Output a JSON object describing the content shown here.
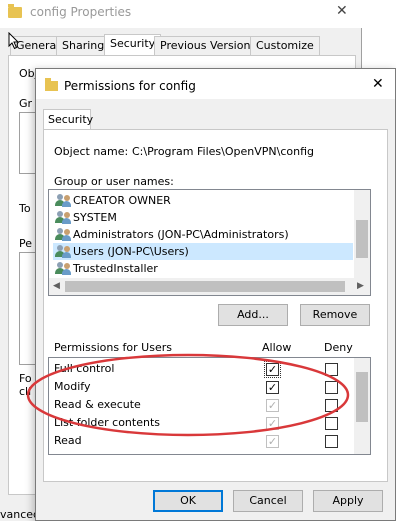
{
  "background_window": {
    "title": "config Properties",
    "tabs": [
      "General",
      "Sharing",
      "Security",
      "Previous Versions",
      "Customize"
    ],
    "fragments": [
      "Object name:",
      "Gr",
      "To",
      "Pe",
      "Fo",
      "cli"
    ],
    "bottom_fragment": "vanced"
  },
  "dialog": {
    "title": "Permissions for config",
    "tab": "Security",
    "object_name_label": "Object name:",
    "object_name_value": "C:\\Program Files\\OpenVPN\\config",
    "group_label": "Group or user names:",
    "users": [
      {
        "name": "CREATOR OWNER",
        "selected": false
      },
      {
        "name": "SYSTEM",
        "selected": false
      },
      {
        "name": "Administrators (JON-PC\\Administrators)",
        "selected": false
      },
      {
        "name": "Users (JON-PC\\Users)",
        "selected": true
      },
      {
        "name": "TrustedInstaller",
        "selected": false
      }
    ],
    "add_button": "Add...",
    "remove_button": "Remove",
    "permissions_label": "Permissions for Users",
    "allow_header": "Allow",
    "deny_header": "Deny",
    "permissions": [
      {
        "name": "Full control",
        "allow": true,
        "allow_enabled": true,
        "deny": false
      },
      {
        "name": "Modify",
        "allow": true,
        "allow_enabled": true,
        "deny": false
      },
      {
        "name": "Read & execute",
        "allow": true,
        "allow_enabled": false,
        "deny": false
      },
      {
        "name": "List folder contents",
        "allow": true,
        "allow_enabled": false,
        "deny": false
      },
      {
        "name": "Read",
        "allow": true,
        "allow_enabled": false,
        "deny": false
      }
    ],
    "ok_button": "OK",
    "cancel_button": "Cancel",
    "apply_button": "Apply"
  },
  "annotation_color": "#d9383a",
  "accent_color": "#0078d7"
}
